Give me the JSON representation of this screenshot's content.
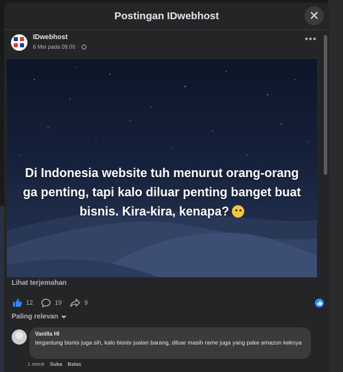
{
  "modal": {
    "title": "Postingan IDwebhost",
    "close_icon": "close-icon"
  },
  "post": {
    "author": "IDwebhost",
    "date": "6 Mei pada 09.00",
    "privacy_icon": "globe-icon",
    "more_icon": "more-icon",
    "text": "Di Indonesia website tuh menurut orang-orang ga penting, tapi kalo diluar penting banget buat bisnis. Kira-kira, kenapa?",
    "emoji": "thinking-face-emoji",
    "translate_label": "Lihat terjemahan"
  },
  "reactions": {
    "likes": "12",
    "comments": "19",
    "shares": "9",
    "icons": [
      "like-icon",
      "comment-icon",
      "share-icon"
    ]
  },
  "comments_section": {
    "sort_label": "Paling relevan",
    "items": [
      {
        "author": "Vanilla HI",
        "text": "tergantung bisnis juga sih, kalo bisnis jualan barang, diluar masih rame juga yang pake amazon keknya",
        "time": "1 menit",
        "like_label": "Suka",
        "reply_label": "Balas"
      }
    ]
  },
  "colors": {
    "modal_bg": "#242526",
    "bubble_bg": "#3a3b3c",
    "accent_blue": "#2d88ff",
    "text_primary": "#e4e6eb",
    "text_secondary": "#b0b3b8"
  }
}
